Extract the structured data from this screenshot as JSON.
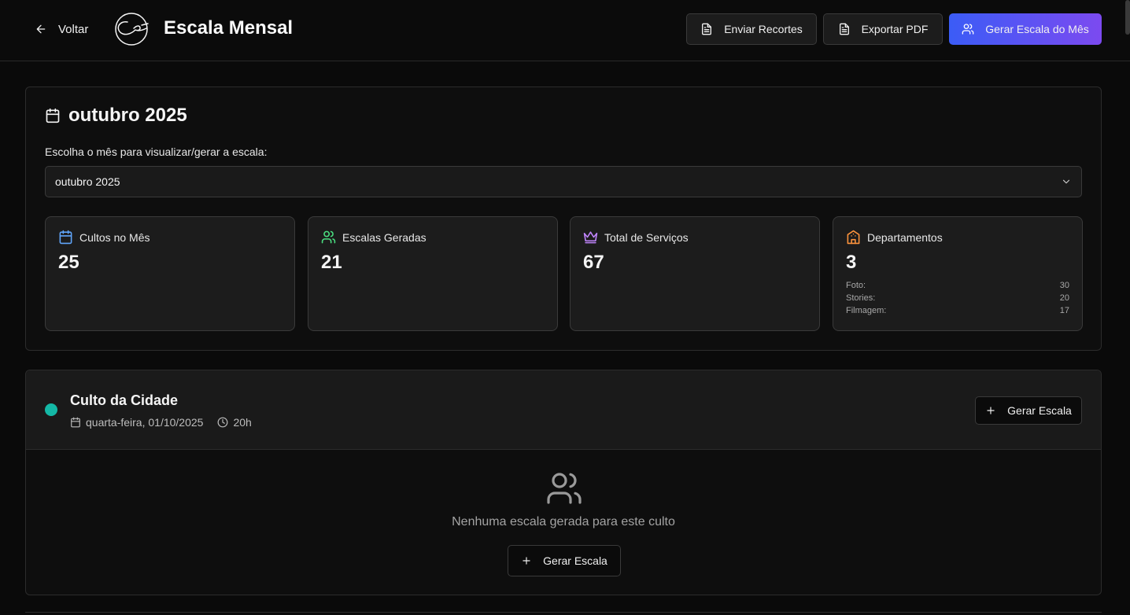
{
  "header": {
    "back_label": "Voltar",
    "title": "Escala Mensal",
    "buttons": {
      "send_clips": "Enviar Recortes",
      "export_pdf": "Exportar PDF",
      "generate_month": "Gerar Escala do Mês"
    }
  },
  "month_card": {
    "title": "outubro 2025",
    "choose_label": "Escolha o mês para visualizar/gerar a escala:",
    "selected_month": "outubro 2025"
  },
  "stats": [
    {
      "label": "Cultos no Mês",
      "value": "25",
      "icon": "calendar-icon",
      "color": "#60a5fa"
    },
    {
      "label": "Escalas Geradas",
      "value": "21",
      "icon": "users-icon",
      "color": "#4ade80"
    },
    {
      "label": "Total de Serviços",
      "value": "67",
      "icon": "crown-icon",
      "color": "#c084fc"
    },
    {
      "label": "Departamentos",
      "value": "3",
      "icon": "building-icon",
      "color": "#fb923c"
    }
  ],
  "departments": [
    {
      "name": "Foto:",
      "count": "30"
    },
    {
      "name": "Stories:",
      "count": "20"
    },
    {
      "name": "Filmagem:",
      "count": "17"
    }
  ],
  "culto": {
    "name": "Culto da Cidade",
    "date": "quarta-feira, 01/10/2025",
    "time": "20h",
    "status_color": "#14b8a6",
    "generate_label": "Gerar Escala",
    "empty_text": "Nenhuma escala gerada para este culto",
    "empty_generate_label": "Gerar Escala"
  }
}
